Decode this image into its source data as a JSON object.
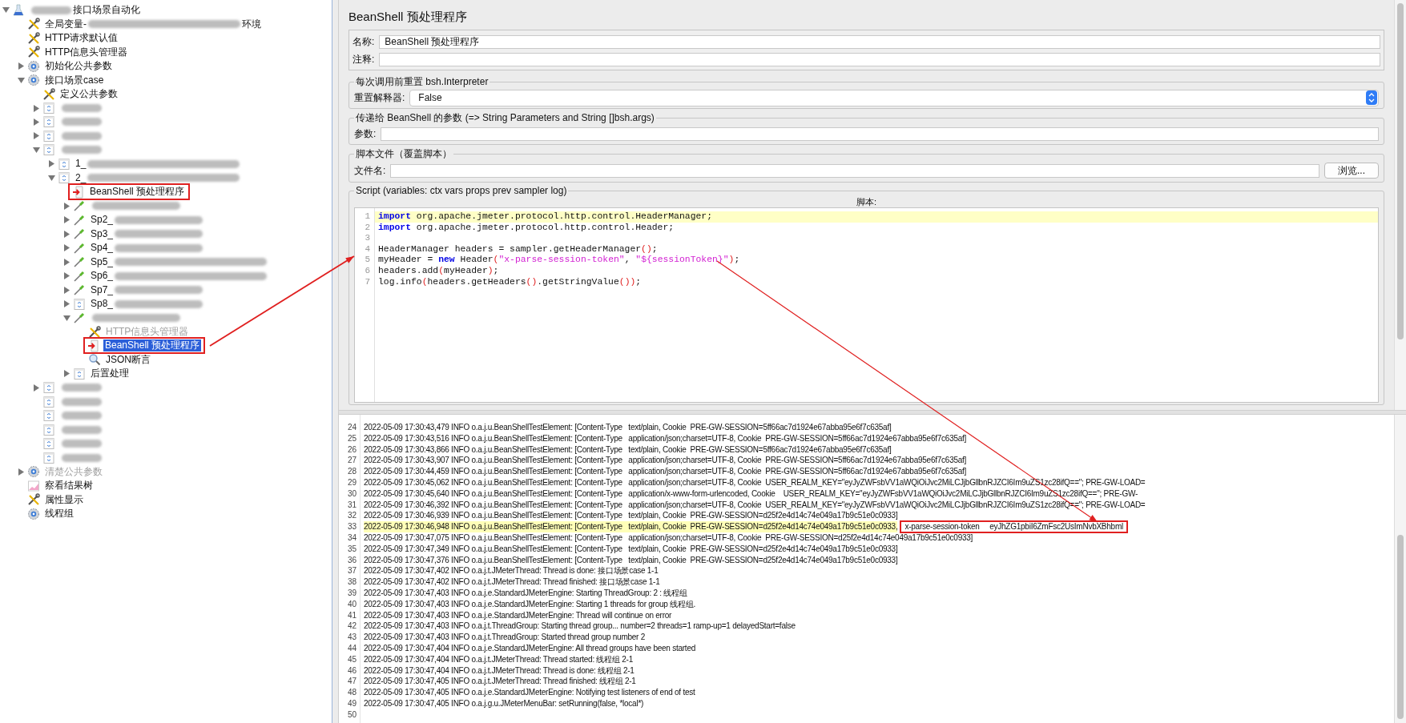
{
  "tree": [
    {
      "kind": "flask",
      "expanded": true,
      "selected": false,
      "segments": [
        {
          "kind": "redacted_short"
        },
        {
          "kind": "text",
          "text": "接口场景自动化"
        }
      ],
      "children": [
        {
          "kind": "wrench",
          "selected": false,
          "segments": [
            {
              "kind": "text",
              "text": "全局变量-"
            },
            {
              "kind": "redacted_long"
            },
            {
              "kind": "text",
              "text": "环境"
            }
          ]
        },
        {
          "kind": "wrench",
          "selected": false,
          "segments": [
            {
              "kind": "text",
              "text": "HTTP请求默认值"
            }
          ]
        },
        {
          "kind": "wrench",
          "selected": false,
          "segments": [
            {
              "kind": "text",
              "text": "HTTP信息头管理器"
            }
          ]
        },
        {
          "kind": "gear",
          "expanded": false,
          "selected": false,
          "segments": [
            {
              "kind": "text",
              "text": "初始化公共参数"
            }
          ]
        },
        {
          "kind": "gear",
          "expanded": true,
          "selected": false,
          "segments": [
            {
              "kind": "text",
              "text": "接口场景case"
            }
          ],
          "children": [
            {
              "kind": "wrench",
              "selected": false,
              "segments": [
                {
                  "kind": "text",
                  "text": "定义公共参数"
                }
              ]
            },
            {
              "kind": "controller",
              "expanded": false,
              "selected": false,
              "segments": [
                {
                  "kind": "redacted_short"
                }
              ]
            },
            {
              "kind": "controller",
              "expanded": false,
              "selected": false,
              "segments": [
                {
                  "kind": "redacted_short"
                }
              ]
            },
            {
              "kind": "controller",
              "expanded": false,
              "selected": false,
              "segments": [
                {
                  "kind": "redacted_short"
                }
              ]
            },
            {
              "kind": "controller",
              "expanded": true,
              "selected": false,
              "segments": [
                {
                  "kind": "redacted_short"
                }
              ],
              "children": [
                {
                  "kind": "controller",
                  "expanded": false,
                  "selected": false,
                  "segments": [
                    {
                      "kind": "text",
                      "text": "1_"
                    },
                    {
                      "kind": "redacted_long"
                    }
                  ]
                },
                {
                  "kind": "controller",
                  "expanded": true,
                  "selected": false,
                  "segments": [
                    {
                      "kind": "text",
                      "text": "2_"
                    },
                    {
                      "kind": "redacted_long"
                    }
                  ],
                  "children": [
                    {
                      "kind": "beanshell",
                      "selected": false,
                      "annotated": true,
                      "segments": [
                        {
                          "kind": "text",
                          "text": "BeanShell 预处理程序"
                        }
                      ]
                    },
                    {
                      "kind": "sampler",
                      "expanded": false,
                      "selected": false,
                      "segments": [
                        {
                          "kind": "redacted"
                        }
                      ]
                    },
                    {
                      "kind": "sampler",
                      "expanded": false,
                      "selected": false,
                      "segments": [
                        {
                          "kind": "text",
                          "text": "Sp2_"
                        },
                        {
                          "kind": "redacted"
                        }
                      ]
                    },
                    {
                      "kind": "sampler",
                      "expanded": false,
                      "selected": false,
                      "segments": [
                        {
                          "kind": "text",
                          "text": "Sp3_"
                        },
                        {
                          "kind": "redacted"
                        }
                      ]
                    },
                    {
                      "kind": "sampler",
                      "expanded": false,
                      "selected": false,
                      "segments": [
                        {
                          "kind": "text",
                          "text": "Sp4_"
                        },
                        {
                          "kind": "redacted"
                        }
                      ]
                    },
                    {
                      "kind": "sampler",
                      "expanded": false,
                      "selected": false,
                      "segments": [
                        {
                          "kind": "text",
                          "text": "Sp5_"
                        },
                        {
                          "kind": "redacted_long"
                        }
                      ]
                    },
                    {
                      "kind": "sampler",
                      "expanded": false,
                      "selected": false,
                      "segments": [
                        {
                          "kind": "text",
                          "text": "Sp6_"
                        },
                        {
                          "kind": "redacted_long"
                        }
                      ]
                    },
                    {
                      "kind": "sampler",
                      "expanded": false,
                      "selected": false,
                      "segments": [
                        {
                          "kind": "text",
                          "text": "Sp7_"
                        },
                        {
                          "kind": "redacted"
                        }
                      ]
                    },
                    {
                      "kind": "controller",
                      "expanded": false,
                      "selected": false,
                      "segments": [
                        {
                          "kind": "text",
                          "text": "Sp8_"
                        },
                        {
                          "kind": "redacted"
                        }
                      ]
                    },
                    {
                      "kind": "sampler",
                      "expanded": true,
                      "selected": false,
                      "segments": [
                        {
                          "kind": "redacted"
                        }
                      ],
                      "children": [
                        {
                          "kind": "wrench",
                          "selected": false,
                          "disabled": true,
                          "segments": [
                            {
                              "kind": "text",
                              "text": "HTTP信息头管理器"
                            }
                          ]
                        },
                        {
                          "kind": "beanshell",
                          "selected": true,
                          "annotated": true,
                          "segments": [
                            {
                              "kind": "text",
                              "text": "BeanShell 预处理程序"
                            }
                          ]
                        },
                        {
                          "kind": "assertion",
                          "selected": false,
                          "segments": [
                            {
                              "kind": "text",
                              "text": "JSON断言"
                            }
                          ]
                        }
                      ]
                    },
                    {
                      "kind": "controller",
                      "expanded": false,
                      "selected": false,
                      "segments": [
                        {
                          "kind": "text",
                          "text": "后置处理"
                        }
                      ]
                    }
                  ]
                }
              ]
            },
            {
              "kind": "controller",
              "expanded": false,
              "selected": false,
              "segments": [
                {
                  "kind": "redacted_short"
                }
              ]
            },
            {
              "kind": "controller",
              "selected": false,
              "segments": [
                {
                  "kind": "redacted_short"
                }
              ]
            },
            {
              "kind": "controller",
              "selected": false,
              "segments": [
                {
                  "kind": "redacted_short"
                }
              ]
            },
            {
              "kind": "controller",
              "selected": false,
              "segments": [
                {
                  "kind": "redacted_short"
                }
              ]
            },
            {
              "kind": "controller",
              "selected": false,
              "segments": [
                {
                  "kind": "redacted_short"
                }
              ]
            },
            {
              "kind": "controller",
              "selected": false,
              "segments": [
                {
                  "kind": "redacted_short"
                }
              ]
            }
          ]
        },
        {
          "kind": "gear",
          "expanded": false,
          "selected": false,
          "disabled": true,
          "segments": [
            {
              "kind": "text",
              "text": "清楚公共参数"
            }
          ]
        },
        {
          "kind": "listener",
          "selected": false,
          "segments": [
            {
              "kind": "text",
              "text": "察看结果树"
            }
          ]
        },
        {
          "kind": "wrench",
          "selected": false,
          "segments": [
            {
              "kind": "text",
              "text": "属性显示"
            }
          ]
        },
        {
          "kind": "gear",
          "selected": false,
          "segments": [
            {
              "kind": "text",
              "text": "线程组"
            }
          ]
        }
      ]
    }
  ],
  "title": "BeanShell 预处理程序",
  "name_field": {
    "label": "名称:",
    "value": "BeanShell 预处理程序"
  },
  "comment_field": {
    "label": "注释:"
  },
  "reset_group": {
    "legend": "每次调用前重置 bsh.Interpreter",
    "label": "重置解释器:",
    "value": "False"
  },
  "params_group": {
    "legend": "传递给 BeanShell 的参数 (=> String Parameters and String []bsh.args)",
    "label": "参数:"
  },
  "file_group": {
    "legend": "脚本文件（覆盖脚本）",
    "label": "文件名:",
    "button": "浏览..."
  },
  "script_group": {
    "legend": "Script (variables: ctx vars props prev sampler log)",
    "label": "脚本:",
    "lines": [
      {
        "number": "1",
        "current": true,
        "tokens": [
          {
            "kind": "keyword",
            "text": "import"
          },
          {
            "kind": "text",
            "text": " org.apache.jmeter.protocol.http.control.HeaderManager;"
          }
        ]
      },
      {
        "number": "2",
        "current": false,
        "tokens": [
          {
            "kind": "keyword",
            "text": "import"
          },
          {
            "kind": "text",
            "text": " org.apache.jmeter.protocol.http.control.Header;"
          }
        ]
      },
      {
        "number": "3"
      },
      {
        "number": "4",
        "current": false,
        "tokens": [
          {
            "kind": "text",
            "text": "HeaderManager headers = sampler.getHeaderManager"
          },
          {
            "kind": "paren",
            "text": "()"
          },
          {
            "kind": "text",
            "text": ";"
          }
        ]
      },
      {
        "number": "5",
        "current": false,
        "tokens": [
          {
            "kind": "text",
            "text": "myHeader = "
          },
          {
            "kind": "keyword",
            "text": "new"
          },
          {
            "kind": "text",
            "text": " Header"
          },
          {
            "kind": "paren",
            "text": "("
          },
          {
            "kind": "string",
            "text": "\"x-parse-session-token\""
          },
          {
            "kind": "text",
            "text": ", "
          },
          {
            "kind": "string",
            "text": "\"${sessionToken}\""
          },
          {
            "kind": "paren",
            "text": ")"
          },
          {
            "kind": "text",
            "text": ";"
          }
        ]
      },
      {
        "number": "6",
        "current": false,
        "tokens": [
          {
            "kind": "text",
            "text": "headers.add"
          },
          {
            "kind": "paren",
            "text": "("
          },
          {
            "kind": "text",
            "text": "myHeader"
          },
          {
            "kind": "paren",
            "text": ")"
          },
          {
            "kind": "text",
            "text": ";"
          }
        ]
      },
      {
        "number": "7",
        "current": false,
        "tokens": [
          {
            "kind": "text",
            "text": "log.info"
          },
          {
            "kind": "paren",
            "text": "("
          },
          {
            "kind": "text",
            "text": "headers.getHeaders"
          },
          {
            "kind": "paren",
            "text": "()"
          },
          {
            "kind": "text",
            "text": ".getStringValue"
          },
          {
            "kind": "paren",
            "text": "())"
          },
          {
            "kind": "text",
            "text": ";"
          }
        ]
      }
    ]
  },
  "log": {
    "lines": [
      {
        "number": "24",
        "highlighted": false,
        "text": "2022-05-09 17:30:43,479 INFO o.a.j.u.BeanShellTestElement: [Content-Type   text/plain, Cookie  PRE-GW-SESSION=5ff66ac7d1924e67abba95e6f7c635af]"
      },
      {
        "number": "25",
        "highlighted": false,
        "text": "2022-05-09 17:30:43,516 INFO o.a.j.u.BeanShellTestElement: [Content-Type   application/json;charset=UTF-8, Cookie  PRE-GW-SESSION=5ff66ac7d1924e67abba95e6f7c635af]"
      },
      {
        "number": "26",
        "highlighted": false,
        "text": "2022-05-09 17:30:43,866 INFO o.a.j.u.BeanShellTestElement: [Content-Type   text/plain, Cookie  PRE-GW-SESSION=5ff66ac7d1924e67abba95e6f7c635af]"
      },
      {
        "number": "27",
        "highlighted": false,
        "text": "2022-05-09 17:30:43,907 INFO o.a.j.u.BeanShellTestElement: [Content-Type   application/json;charset=UTF-8, Cookie  PRE-GW-SESSION=5ff66ac7d1924e67abba95e6f7c635af]"
      },
      {
        "number": "28",
        "highlighted": false,
        "text": "2022-05-09 17:30:44,459 INFO o.a.j.u.BeanShellTestElement: [Content-Type   application/json;charset=UTF-8, Cookie  PRE-GW-SESSION=5ff66ac7d1924e67abba95e6f7c635af]"
      },
      {
        "number": "29",
        "highlighted": false,
        "text": "2022-05-09 17:30:45,062 INFO o.a.j.u.BeanShellTestElement: [Content-Type   application/json;charset=UTF-8, Cookie  USER_REALM_KEY=\"eyJyZWFsbVV1aWQiOiJvc2MiLCJjbGllbnRJZCI6Im9uZS1zc28ifQ==\"; PRE-GW-LOAD="
      },
      {
        "number": "30",
        "highlighted": false,
        "text": "2022-05-09 17:30:45,640 INFO o.a.j.u.BeanShellTestElement: [Content-Type   application/x-www-form-urlencoded, Cookie    USER_REALM_KEY=\"eyJyZWFsbVV1aWQiOiJvc2MiLCJjbGllbnRJZCI6Im9uZS1zc28ifQ==\"; PRE-GW-"
      },
      {
        "number": "31",
        "highlighted": false,
        "text": "2022-05-09 17:30:46,392 INFO o.a.j.u.BeanShellTestElement: [Content-Type   application/json;charset=UTF-8, Cookie  USER_REALM_KEY=\"eyJyZWFsbVV1aWQiOiJvc2MiLCJjbGllbnRJZCI6Im9uZS1zc28ifQ==\"; PRE-GW-LOAD="
      },
      {
        "number": "32",
        "highlighted": false,
        "text": "2022-05-09 17:30:46,939 INFO o.a.j.u.BeanShellTestElement: [Content-Type   text/plain, Cookie  PRE-GW-SESSION=d25f2e4d14c74e049a17b9c51e0c0933]"
      },
      {
        "number": "33",
        "highlighted": true,
        "text": "2022-05-09 17:30:46,948 INFO o.a.j.u.BeanShellTestElement: [Content-Type   text/plain, Cookie  PRE-GW-SESSION=d25f2e4d14c74e049a17b9c51e0c0933,",
        "boxed_text": "x-parse-session-token     eyJhZG1pbiI6ZmFsc2UsImNvbXBhbml"
      },
      {
        "number": "34",
        "highlighted": false,
        "text": "2022-05-09 17:30:47,075 INFO o.a.j.u.BeanShellTestElement: [Content-Type   application/json;charset=UTF-8, Cookie  PRE-GW-SESSION=d25f2e4d14c74e049a17b9c51e0c0933]"
      },
      {
        "number": "35",
        "highlighted": false,
        "text": "2022-05-09 17:30:47,349 INFO o.a.j.u.BeanShellTestElement: [Content-Type   text/plain, Cookie  PRE-GW-SESSION=d25f2e4d14c74e049a17b9c51e0c0933]"
      },
      {
        "number": "36",
        "highlighted": false,
        "text": "2022-05-09 17:30:47,376 INFO o.a.j.u.BeanShellTestElement: [Content-Type   text/plain, Cookie  PRE-GW-SESSION=d25f2e4d14c74e049a17b9c51e0c0933]"
      },
      {
        "number": "37",
        "highlighted": false,
        "text": "2022-05-09 17:30:47,402 INFO o.a.j.t.JMeterThread: Thread is done: 接口场景case 1-1"
      },
      {
        "number": "38",
        "highlighted": false,
        "text": "2022-05-09 17:30:47,402 INFO o.a.j.t.JMeterThread: Thread finished: 接口场景case 1-1"
      },
      {
        "number": "39",
        "highlighted": false,
        "text": "2022-05-09 17:30:47,403 INFO o.a.j.e.StandardJMeterEngine: Starting ThreadGroup: 2 : 线程组"
      },
      {
        "number": "40",
        "highlighted": false,
        "text": "2022-05-09 17:30:47,403 INFO o.a.j.e.StandardJMeterEngine: Starting 1 threads for group 线程组."
      },
      {
        "number": "41",
        "highlighted": false,
        "text": "2022-05-09 17:30:47,403 INFO o.a.j.e.StandardJMeterEngine: Thread will continue on error"
      },
      {
        "number": "42",
        "highlighted": false,
        "text": "2022-05-09 17:30:47,403 INFO o.a.j.t.ThreadGroup: Starting thread group... number=2 threads=1 ramp-up=1 delayedStart=false"
      },
      {
        "number": "43",
        "highlighted": false,
        "text": "2022-05-09 17:30:47,403 INFO o.a.j.t.ThreadGroup: Started thread group number 2"
      },
      {
        "number": "44",
        "highlighted": false,
        "text": "2022-05-09 17:30:47,404 INFO o.a.j.e.StandardJMeterEngine: All thread groups have been started"
      },
      {
        "number": "45",
        "highlighted": false,
        "text": "2022-05-09 17:30:47,404 INFO o.a.j.t.JMeterThread: Thread started: 线程组 2-1"
      },
      {
        "number": "46",
        "highlighted": false,
        "text": "2022-05-09 17:30:47,404 INFO o.a.j.t.JMeterThread: Thread is done: 线程组 2-1"
      },
      {
        "number": "47",
        "highlighted": false,
        "text": "2022-05-09 17:30:47,405 INFO o.a.j.t.JMeterThread: Thread finished: 线程组 2-1"
      },
      {
        "number": "48",
        "highlighted": false,
        "text": "2022-05-09 17:30:47,405 INFO o.a.j.e.StandardJMeterEngine: Notifying test listeners of end of test"
      },
      {
        "number": "49",
        "highlighted": false,
        "text": "2022-05-09 17:30:47,405 INFO o.a.j.g.u.JMeterMenuBar: setRunning(false, *local*)"
      },
      {
        "number": "50"
      }
    ]
  }
}
